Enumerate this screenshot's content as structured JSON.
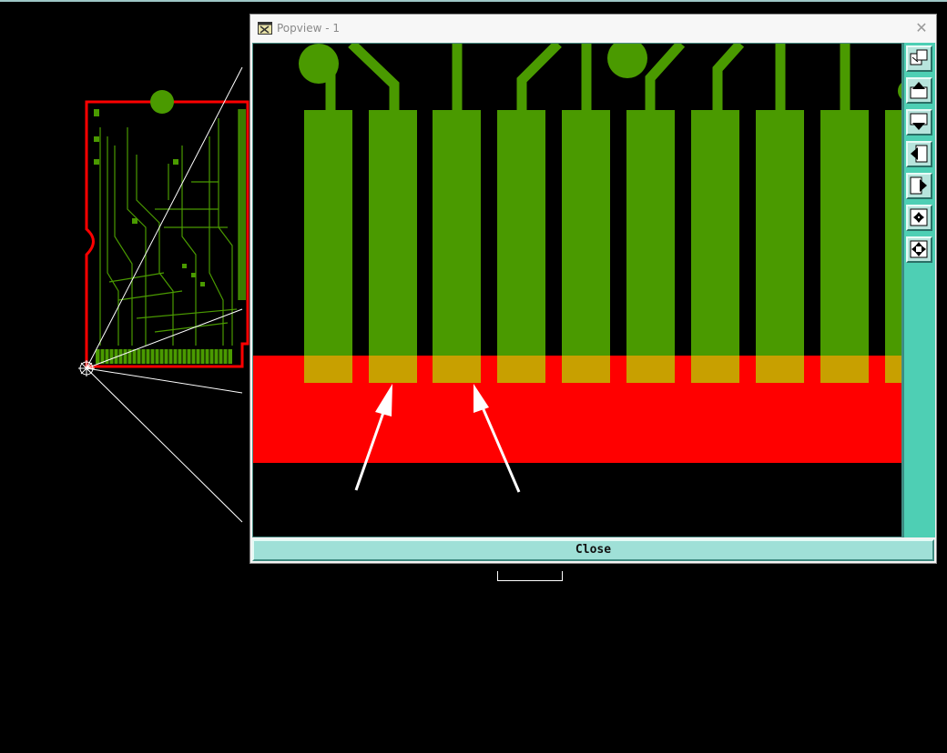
{
  "window": {
    "title": "Popview - 1",
    "close_label": "Close"
  },
  "toolbar": {
    "buttons": [
      {
        "name": "zoom-window-icon"
      },
      {
        "name": "pan-up-icon"
      },
      {
        "name": "pan-down-icon"
      },
      {
        "name": "pan-left-icon"
      },
      {
        "name": "pan-right-icon"
      },
      {
        "name": "zoom-fit-icon"
      },
      {
        "name": "zoom-in-out-icon"
      }
    ]
  },
  "colors": {
    "board_outline": "#ff0000",
    "trace": "#4a9a00",
    "pad_overlap": "#c8a000",
    "toolbar": "#4ecfb4",
    "arrow": "#ffffff"
  }
}
